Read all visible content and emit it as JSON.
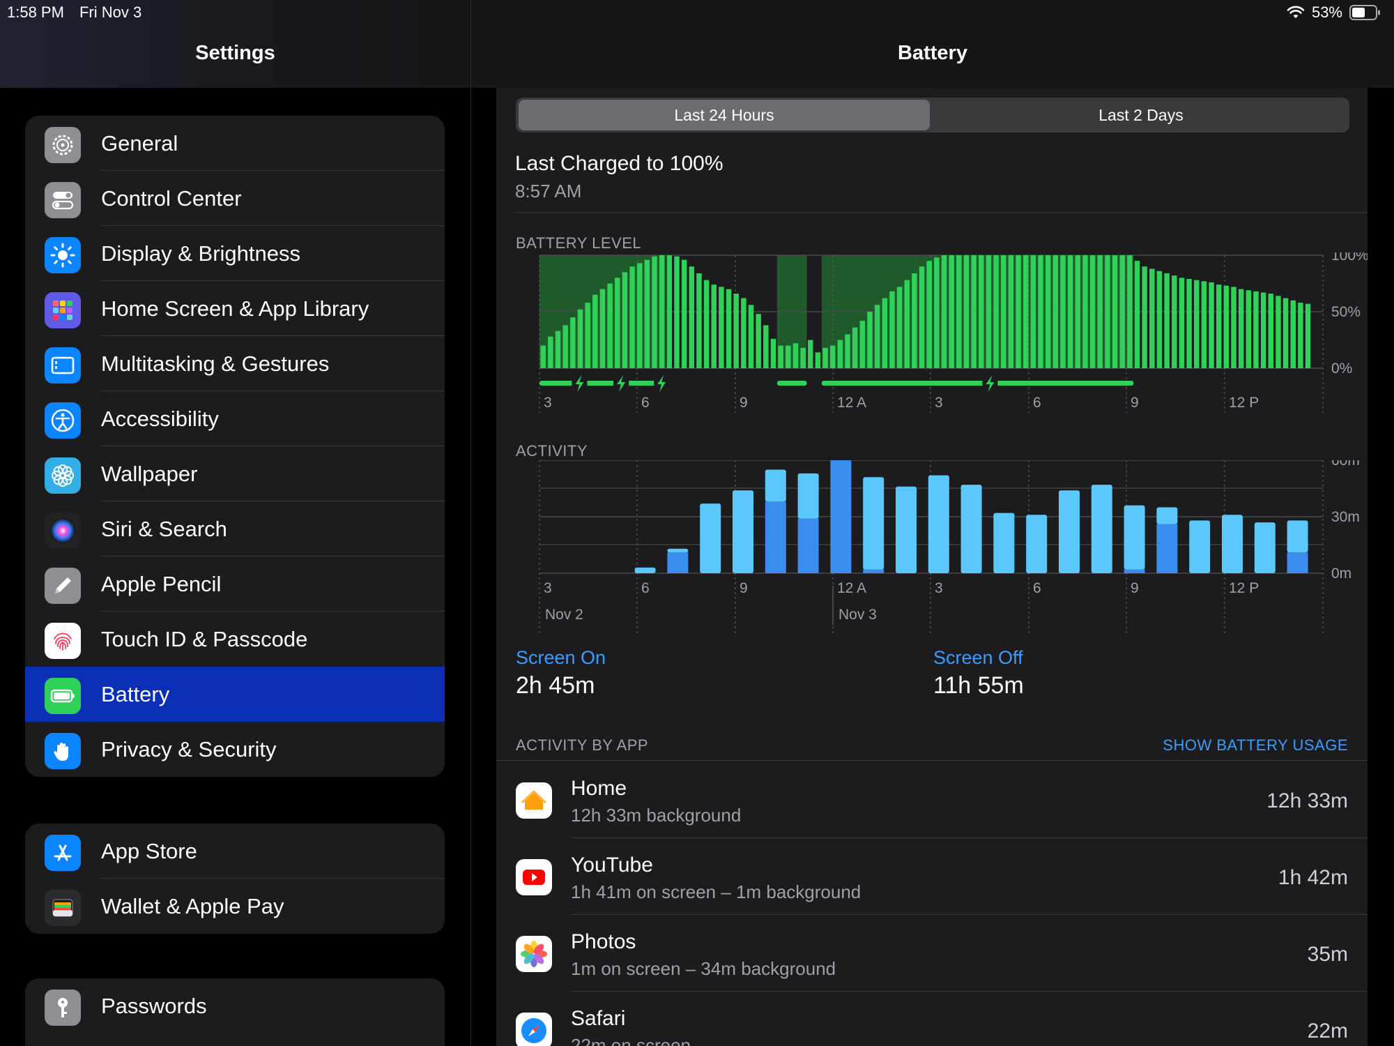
{
  "status": {
    "time": "1:58 PM",
    "date": "Fri Nov 3",
    "battery_pct": "53%"
  },
  "sidebar": {
    "title": "Settings",
    "group1": [
      {
        "label": "General",
        "icon": "gear-icon",
        "color": "#8e8e93"
      },
      {
        "label": "Control Center",
        "icon": "switches-icon",
        "color": "#8e8e93"
      },
      {
        "label": "Display & Brightness",
        "icon": "sun-icon",
        "color": "#0a84ff"
      },
      {
        "label": "Home Screen & App Library",
        "icon": "grid-icon",
        "color": "#5e5ce6"
      },
      {
        "label": "Multitasking & Gestures",
        "icon": "multitask-icon",
        "color": "#0a84ff"
      },
      {
        "label": "Accessibility",
        "icon": "accessibility-icon",
        "color": "#0a84ff"
      },
      {
        "label": "Wallpaper",
        "icon": "flower-icon",
        "color": "#32ade6"
      },
      {
        "label": "Siri & Search",
        "icon": "siri-icon",
        "color": "#222222"
      },
      {
        "label": "Apple Pencil",
        "icon": "pencil-icon",
        "color": "#8e8e93"
      },
      {
        "label": "Touch ID & Passcode",
        "icon": "fingerprint-icon",
        "color": "#ffffff"
      },
      {
        "label": "Battery",
        "icon": "battery-icon",
        "color": "#30d158",
        "selected": true
      },
      {
        "label": "Privacy & Security",
        "icon": "hand-icon",
        "color": "#0a84ff"
      }
    ],
    "group2": [
      {
        "label": "App Store",
        "icon": "app-store-icon",
        "color": "#0a84ff"
      },
      {
        "label": "Wallet & Apple Pay",
        "icon": "wallet-icon",
        "color": "#2c2c2e"
      }
    ],
    "group3": [
      {
        "label": "Passwords",
        "icon": "key-icon",
        "color": "#8e8e93"
      }
    ]
  },
  "main": {
    "title": "Battery",
    "segments": [
      "Last 24 Hours",
      "Last 2 Days"
    ],
    "active_segment": 0,
    "last_charged": "Last Charged to 100%",
    "last_charged_time": "8:57 AM",
    "battery_level_label": "BATTERY LEVEL",
    "activity_label": "ACTIVITY",
    "screen_on_label": "Screen On",
    "screen_on_value": "2h 45m",
    "screen_off_label": "Screen Off",
    "screen_off_value": "11h 55m",
    "activity_by_app_label": "ACTIVITY BY APP",
    "show_usage_link": "SHOW BATTERY USAGE",
    "apps": [
      {
        "name": "Home",
        "detail": "12h 33m background",
        "time": "12h 33m",
        "icon": "home-app-icon"
      },
      {
        "name": "YouTube",
        "detail": "1h 41m on screen – 1m background",
        "time": "1h 42m",
        "icon": "youtube-app-icon"
      },
      {
        "name": "Photos",
        "detail": "1m on screen – 34m background",
        "time": "35m",
        "icon": "photos-app-icon"
      },
      {
        "name": "Safari",
        "detail": "22m on screen",
        "time": "22m",
        "icon": "safari-app-icon"
      }
    ]
  },
  "chart_data": [
    {
      "type": "bar",
      "title": "BATTERY LEVEL",
      "x_tick_labels": [
        "3",
        "6",
        "9",
        "12 A",
        "3",
        "6",
        "9",
        "12 P"
      ],
      "y_tick_labels": [
        "100%",
        "50%",
        "0%"
      ],
      "ylim": [
        0,
        100
      ],
      "values": [
        20,
        28,
        33,
        38,
        45,
        52,
        58,
        65,
        70,
        75,
        80,
        85,
        90,
        93,
        96,
        99,
        100,
        100,
        99,
        96,
        90,
        84,
        78,
        74,
        72,
        70,
        66,
        62,
        56,
        48,
        38,
        26,
        20,
        20,
        22,
        18,
        25,
        14,
        18,
        20,
        25,
        30,
        36,
        42,
        50,
        56,
        62,
        68,
        72,
        78,
        84,
        90,
        95,
        98,
        100,
        100,
        100,
        100,
        100,
        100,
        100,
        100,
        100,
        100,
        100,
        100,
        100,
        100,
        100,
        100,
        100,
        100,
        100,
        100,
        100,
        100,
        100,
        100,
        100,
        100,
        95,
        90,
        88,
        86,
        84,
        82,
        80,
        79,
        78,
        77,
        76,
        74,
        73,
        72,
        70,
        69,
        68,
        67,
        66,
        64,
        62,
        60,
        58,
        57
      ],
      "charging_periods": [
        [
          0,
          17
        ],
        [
          32,
          36
        ],
        [
          38,
          80
        ]
      ]
    },
    {
      "type": "bar",
      "title": "ACTIVITY",
      "x_tick_labels": [
        "3",
        "6",
        "9",
        "12 A",
        "3",
        "6",
        "9",
        "12 P"
      ],
      "date_labels": [
        "Nov 2",
        "Nov 3"
      ],
      "y_tick_labels": [
        "60m",
        "30m",
        "0m"
      ],
      "ylim": [
        0,
        60
      ],
      "series": [
        {
          "name": "Screen On",
          "values": [
            0,
            0,
            0,
            3,
            11,
            37,
            44,
            28,
            18,
            0,
            0,
            0,
            0,
            0,
            0,
            0,
            0,
            0,
            0,
            0,
            0,
            0,
            0,
            0,
            0,
            0,
            0,
            0,
            0,
            0,
            0,
            0,
            0,
            0,
            0,
            0,
            0,
            0,
            0,
            0,
            0,
            0,
            0,
            0,
            0,
            0,
            0,
            0,
            0,
            0,
            0,
            0
          ]
        },
        {
          "name": "Screen Off",
          "values": [
            0,
            0,
            0,
            0,
            2,
            1,
            1,
            0,
            0,
            0,
            0,
            0,
            0,
            0,
            0,
            0,
            0,
            0,
            0,
            0,
            0,
            0,
            0,
            0,
            0,
            0,
            0,
            0,
            0,
            0,
            0,
            0,
            0,
            0,
            0,
            0,
            0,
            0,
            0,
            0,
            0,
            0,
            0,
            0,
            0,
            0,
            0,
            0,
            0,
            0,
            0,
            0
          ]
        }
      ],
      "bars": [
        {
          "on": 0,
          "off": 0
        },
        {
          "on": 0,
          "off": 0
        },
        {
          "on": 0,
          "off": 3
        },
        {
          "on": 11,
          "off": 2
        },
        {
          "on": 0,
          "off": 37
        },
        {
          "on": 0,
          "off": 44
        },
        {
          "on": 38,
          "off": 17
        },
        {
          "on": 29,
          "off": 24
        },
        {
          "on": 60,
          "off": 0
        },
        {
          "on": 2,
          "off": 49
        },
        {
          "on": 0,
          "off": 46
        },
        {
          "on": 0,
          "off": 52
        },
        {
          "on": 0,
          "off": 47
        },
        {
          "on": 0,
          "off": 32
        },
        {
          "on": 0,
          "off": 31
        },
        {
          "on": 0,
          "off": 44
        },
        {
          "on": 0,
          "off": 47
        },
        {
          "on": 2,
          "off": 34
        },
        {
          "on": 26,
          "off": 9
        },
        {
          "on": 0,
          "off": 28
        },
        {
          "on": 0,
          "off": 31
        },
        {
          "on": 0,
          "off": 27
        },
        {
          "on": 11,
          "off": 17
        }
      ]
    }
  ]
}
